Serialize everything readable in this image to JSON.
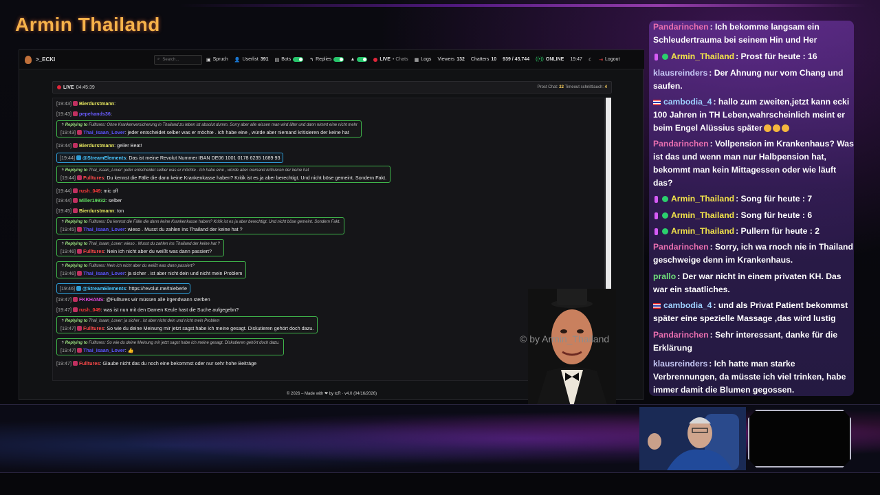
{
  "overlay": {
    "channel_title": "Armin Thailand",
    "watermark": "© by Armin_Thailand"
  },
  "app": {
    "brand": ">_ECKI",
    "search_placeholder": "Search...",
    "nav": {
      "spruch": "Spruch",
      "userlist": "Userlist",
      "userlist_count": "391",
      "bots": "Bots",
      "replies": "Replies",
      "live": "LIVE",
      "chats": "• Chats",
      "logs": "Logs",
      "viewers_label": "Viewers",
      "viewers": "132",
      "chatters_label": "Chatters",
      "chatters": "10",
      "ratio": "939 / 45.744",
      "status": "ONLINE",
      "time": "19:47",
      "logout": "Logout"
    },
    "live_bar": {
      "label": "LIVE",
      "uptime": "04:45:39",
      "prost_label": "Prost Chat:",
      "prost_value": "22",
      "timeout_label": "Timeout schnittlauch:",
      "timeout_value": "4"
    },
    "footer": "© 2026 – Made with ❤ by tcR · v4.0 (04/16/2026)",
    "colors": {
      "reply_border": "#3fb54a",
      "stream_border": "#2d9cd6",
      "live_red": "#e0263a",
      "online_green": "#2fd46c"
    }
  },
  "chat_log": [
    {
      "ts": "[19:43]",
      "user": "Bierdurstmann",
      "color": "#e8e860",
      "text": ":"
    },
    {
      "ts": "[19:43]",
      "user": "pepehands36",
      "color": "#6a5cff",
      "text": ":"
    },
    {
      "reply_to": "Fulltures",
      "reply_text": ": Ohne Krankenversicherung in Thailand zu leben ist absolut dumm. Sorry aber alle wissen man wird älter und dann nimmt eine nicht mehr",
      "ts": "[19:43]",
      "user": "Thai_Isaan_Lover",
      "color": "#5a55ff",
      "text": ": jeder entscheidet selber was er möchte . Ich habe eine , würde aber niemand kritisieren der keine hat"
    },
    {
      "ts": "[19:44]",
      "user": "Bierdurstmann",
      "color": "#e8e860",
      "text": ": geiler Beat!"
    },
    {
      "stream": true,
      "ts": "[19:44]",
      "user": "@StreamElements",
      "color": "#49c7ff",
      "text": ": Das ist meine Revolut Nummer IBAN DE06 1001 0178 6235 1689 93"
    },
    {
      "reply_to": "Thai_Isaan_Lover",
      "reply_text": ": jeder entscheidet selber was er möchte . Ich habe eine , würde aber niemand kritisieren der keine hat",
      "ts": "[19:44]",
      "user": "Fulltures",
      "color": "#ff4a4a",
      "text": ": Du kennst die Fälle die dann keine Krankenkasse haben? Kritik ist es ja aber berechtigt. Und nicht böse gemeint. Sondern Fakt."
    },
    {
      "ts": "[19:44]",
      "user": "rush_049",
      "color": "#ff3a3a",
      "text": ": mic off"
    },
    {
      "ts": "[19:44]",
      "user": "Miller19932",
      "color": "#63e063",
      "text": ": selber"
    },
    {
      "ts": "[19:45]",
      "user": "Bierdurstmann",
      "color": "#e8e860",
      "text": ": ton"
    },
    {
      "reply_to": "Fulltures",
      "reply_text": ": Du kennst die Fälle die dann keine Krankenkasse haben? Kritik ist es ja aber berechtigt. Und nicht böse gemeint. Sondern Fakt.",
      "ts": "[19:45]",
      "user": "Thai_Isaan_Lover",
      "color": "#5a55ff",
      "text": ": wieso . Musst du zahlen ins Thailand der keine hat ?"
    },
    {
      "reply_to": "Thai_Isaan_Lover",
      "reply_text": ": wieso . Musst du zahlen ins Thailand der keine hat ?",
      "ts": "[19:46]",
      "user": "Fulltures",
      "color": "#ff4a4a",
      "text": ": Nein ich nicht aber du weißt was dann passiert?"
    },
    {
      "reply_to": "Fulltures",
      "reply_text": ": Nein ich nicht aber du weißt was dann passiert?",
      "ts": "[19:46]",
      "user": "Thai_Isaan_Lover",
      "color": "#5a55ff",
      "text": ": ja sicher . ist aber nicht dein und nicht mein Problem"
    },
    {
      "stream": true,
      "ts": "[19:46]",
      "user": "@StreamElements",
      "color": "#49c7ff",
      "text": ": https://revolut.me/tnieberle"
    },
    {
      "ts": "[19:47]",
      "user": "FKKHANS",
      "color": "#e04ae0",
      "text": ": @Fulltures wir müssen alle irgendwann sterben"
    },
    {
      "ts": "[19:47]",
      "user": "rush_049",
      "color": "#ff3a3a",
      "text": ": was ist nun mit den Damen Keule hast die Suche aufgegebn?"
    },
    {
      "reply_to": "Thai_Isaan_Lover",
      "reply_text": ": ja sicher . ist aber nicht dein und nicht mein Problem",
      "ts": "[19:47]",
      "user": "Fulltures",
      "color": "#ff4a4a",
      "text": ": So wie du deine Meinung mir jetzt sagst habe ich meine gesagt. Diskutieren gehört doch dazu."
    },
    {
      "reply_to": "Fulltures",
      "reply_text": ": So wie du deine Meinung mir jetzt sagst habe ich meine gesagt. Diskutieren gehört doch dazu.",
      "ts": "[19:47]",
      "user": "Thai_Isaan_Lover",
      "color": "#5a55ff",
      "text": ": 👍"
    },
    {
      "ts": "[19:47]",
      "user": "Fulltures",
      "color": "#ff4a4a",
      "text": ": Glaube nicht das du noch eine bekommst oder nur sehr hohe Beiträge"
    }
  ],
  "reply_prefix": "Replying to",
  "side_chat": [
    {
      "user": "Pandarinchen",
      "cls": "u-panda",
      "text": ": Ich bekomme langsam ein Schleudertrauma bei seinem Hin und Her"
    },
    {
      "user": "Armin_Thailand",
      "cls": "u-armin",
      "badges": "mod",
      "text": ": Prost für heute : 16"
    },
    {
      "user": "klausreinders",
      "cls": "u-klaus",
      "text": ": Der Ahnung nur vom Chang und saufen."
    },
    {
      "user": "cambodia_4",
      "cls": "u-camb",
      "badges": "flag",
      "text": ": hallo zum zweiten,jetzt kann ecki 100 Jahren in TH Leben,wahrscheinlich meint er beim Engel Alüssius später"
    },
    {
      "user": "Pandarinchen",
      "cls": "u-panda",
      "text": ": Vollpension im Krankenhaus? Was ist das und wenn man nur Halbpension hat, bekommt man kein Mittagessen oder wie läuft das?"
    },
    {
      "user": "Armin_Thailand",
      "cls": "u-armin",
      "badges": "mod",
      "text": ": Song für heute : 7"
    },
    {
      "user": "Armin_Thailand",
      "cls": "u-armin",
      "badges": "mod",
      "text": ": Song für heute : 6"
    },
    {
      "user": "Armin_Thailand",
      "cls": "u-armin",
      "badges": "mod",
      "text": ": Pullern für heute : 2"
    },
    {
      "user": "Pandarinchen",
      "cls": "u-panda",
      "text": ": Sorry, ich wa rnoch nie in Thailand geschweige denn im Krankenhaus."
    },
    {
      "user": "prallo",
      "cls": "u-prallo",
      "text": ": Der war nicht in einem privaten KH. Das war ein staatliches."
    },
    {
      "user": "cambodia_4",
      "cls": "u-camb",
      "badges": "flag",
      "text": ": und als Privat Patient bekommst später eine spezielle Massage ,das wird lustig"
    },
    {
      "user": "Pandarinchen",
      "cls": "u-panda",
      "text": ": Sehr interessant, danke für die Erklärung"
    },
    {
      "user": "klausreinders",
      "cls": "u-klaus",
      "text": ": Ich hatte man starke Verbrennungen, da müsste ich viel trinken, habe immer damit die Blumen gegossen."
    }
  ]
}
